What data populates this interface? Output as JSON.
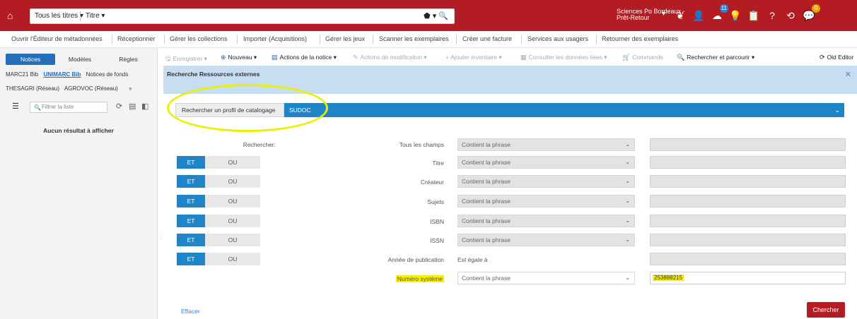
{
  "topbar": {
    "search_scope": "Tous les titres ▾",
    "search_type": "Titre  ▾",
    "search_tools": "⬟ ▾   🔍",
    "institution_line1": "Sciences Po Bordeaux -",
    "institution_line2": "Prêt-Retour",
    "notif_count": "11",
    "alert_count": "0"
  },
  "menu": [
    "Ouvrir l'Éditeur de métadonnées",
    "Réceptionner",
    "Gérer les collections",
    "Importer (Acquisitions)",
    "Gérer les jeux",
    "Scanner les exemplaires",
    "Créer une facture",
    "Services aux usagers",
    "Retourner des exemplaires"
  ],
  "left": {
    "tabs": [
      "Notices",
      "Modèles",
      "Règles"
    ],
    "profiles_row1": [
      "MARC21 Bib",
      "UNIMARC Bib",
      "Notices de fonds"
    ],
    "profiles_row2": [
      "THESAGRI (Réseau)",
      "AGROVOC (Réseau)",
      "⩔"
    ],
    "filter_placeholder": "Filtrer la liste",
    "empty": "Aucun résultat à afficher"
  },
  "toolbar": {
    "enregistrer": "Enregistrer ▾",
    "nouveau": "Nouveau ▾",
    "actions_notice": "Actions de la notice ▾",
    "actions_modif": "Actions de modification ▾",
    "ajouter_inventaire": "+ Ajouter inventaire ▾",
    "consulter": "Consulter les données liées ▾",
    "commande": "Commande",
    "rechercher": "Rechercher et parcourir ▾",
    "old_editor": "Old Editor"
  },
  "panel": {
    "title": "Recherche Ressources externes",
    "profile_label": "Rechercher un profil de catalogage",
    "profile_value": "SUDOC"
  },
  "form": {
    "rechercher_label": "Rechercher:",
    "et": "ET",
    "ou": "OU",
    "rows": [
      {
        "field": "Tous les champs",
        "cond": "Contient la phrase",
        "value": ""
      },
      {
        "field": "Titre",
        "cond": "Contient la phrase",
        "value": ""
      },
      {
        "field": "Créateur",
        "cond": "Contient la phrase",
        "value": ""
      },
      {
        "field": "Sujets",
        "cond": "Contient la phrase",
        "value": ""
      },
      {
        "field": "ISBN",
        "cond": "Contient la phrase",
        "value": ""
      },
      {
        "field": "ISSN",
        "cond": "Contient la phrase",
        "value": ""
      },
      {
        "field": "Année de publication",
        "cond": "Est égale à",
        "value": ""
      },
      {
        "field": "Numéro système",
        "cond": "Contient la phrase",
        "value": "253888215"
      }
    ],
    "effacer": "Effacer",
    "chercher": "Chercher"
  },
  "colors": {
    "brand_red": "#b41c23",
    "accent_blue": "#1d85c8",
    "highlight_yellow": "#f7f000"
  }
}
